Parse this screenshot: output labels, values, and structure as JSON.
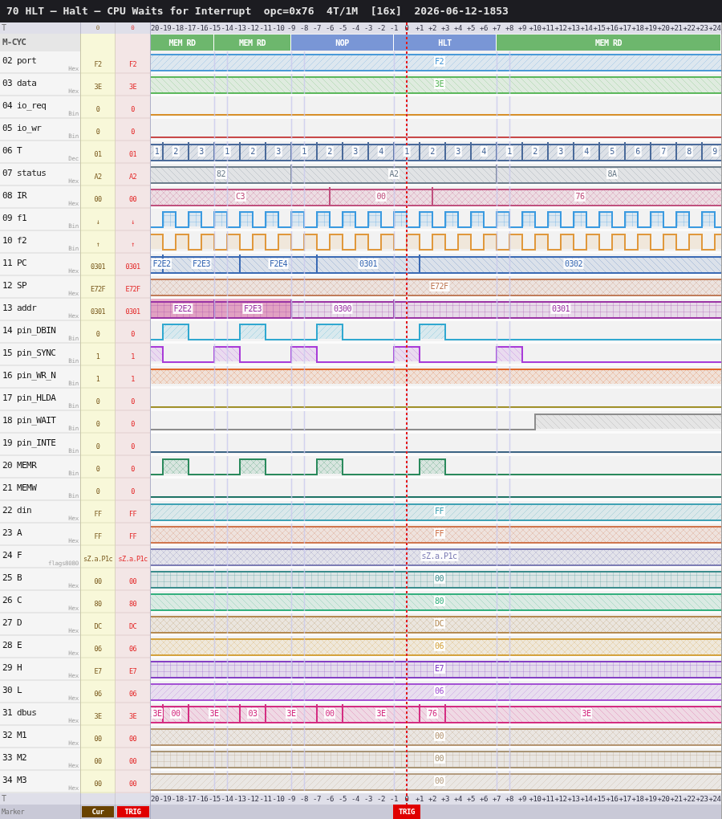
{
  "title_bar": {
    "title": "70 HLT — Halt — CPU Waits for Interrupt",
    "opcode": "opc=0x76",
    "timing": "4T/1M",
    "zoom": "[16x]",
    "timestamp": "2026-06-12-1853"
  },
  "ruler_top": {
    "label": "T",
    "cursor_value": "0",
    "trigger_value": "0",
    "ticks": [
      "20",
      "-19",
      "-18",
      "-17",
      "-16",
      "-15",
      "-14",
      "-13",
      "-12",
      "-11",
      "-10",
      "-9",
      "-8",
      "-7",
      "-6",
      "-5",
      "-4",
      "-3",
      "-2",
      "-1",
      "0",
      "+1",
      "+2",
      "+3",
      "+4",
      "+5",
      "+6",
      "+7",
      "+8",
      "+9",
      "+10",
      "+11",
      "+12",
      "+13",
      "+14",
      "+15",
      "+16",
      "+17",
      "+18",
      "+19",
      "+20",
      "+21",
      "+22",
      "+23",
      "+24"
    ]
  },
  "machine_cycles": {
    "label": "M-CYC",
    "segments": [
      {
        "label": "MEM RD",
        "color": "#6db76d"
      },
      {
        "label": "MEM RD",
        "color": "#6db76d"
      },
      {
        "label": "NOP",
        "color": "#7996d6"
      },
      {
        "label": "HLT",
        "color": "#7996d6"
      },
      {
        "label": "MEM RD",
        "color": "#6db76d"
      }
    ]
  },
  "signals": [
    {
      "name": "02 port",
      "format": "Hex",
      "cursor_value": "F2",
      "trigger_value": "F2",
      "kind": "bus",
      "color": "#4a9ad8",
      "segments": [
        {
          "value": "F2"
        }
      ]
    },
    {
      "name": "03 data",
      "format": "Hex",
      "cursor_value": "3E",
      "trigger_value": "3E",
      "kind": "bus",
      "color": "#5cb85c",
      "segments": [
        {
          "value": "3E"
        }
      ]
    },
    {
      "name": "04 io_req",
      "format": "Bin",
      "cursor_value": "0",
      "trigger_value": "0",
      "kind": "bit",
      "color": "#d8902a"
    },
    {
      "name": "05 io_wr",
      "format": "Bin",
      "cursor_value": "0",
      "trigger_value": "0",
      "kind": "bit",
      "color": "#c84848"
    },
    {
      "name": "06 T",
      "format": "Dec",
      "cursor_value": "01",
      "trigger_value": "01",
      "kind": "bus",
      "color": "#4a6a9a",
      "segments": [
        {
          "value": "1"
        },
        {
          "value": "2"
        },
        {
          "value": "3"
        },
        {
          "value": "1"
        },
        {
          "value": "2"
        },
        {
          "value": "3"
        },
        {
          "value": "1"
        },
        {
          "value": "2"
        },
        {
          "value": "3"
        },
        {
          "value": "4"
        },
        {
          "value": "1"
        },
        {
          "value": "2"
        },
        {
          "value": "3"
        },
        {
          "value": "4"
        },
        {
          "value": "1"
        },
        {
          "value": "2"
        },
        {
          "value": "3"
        },
        {
          "value": "4"
        },
        {
          "value": "5"
        },
        {
          "value": "6"
        },
        {
          "value": "7"
        },
        {
          "value": "8"
        },
        {
          "value": "9"
        }
      ]
    },
    {
      "name": "07 status",
      "format": "Hex",
      "cursor_value": "A2",
      "trigger_value": "A2",
      "kind": "bus",
      "color": "#6e7e8c",
      "segments": [
        {
          "value": "82"
        },
        {
          "value": "A2"
        },
        {
          "value": "8A"
        }
      ]
    },
    {
      "name": "08 IR",
      "format": "Hex",
      "cursor_value": "00",
      "trigger_value": "00",
      "kind": "bus",
      "color": "#c0507e",
      "segments": [
        {
          "value": "C3"
        },
        {
          "value": "00"
        },
        {
          "value": "76"
        }
      ]
    },
    {
      "name": "09 f1",
      "format": "Bin",
      "cursor_value": "↓",
      "trigger_value": "↓",
      "kind": "bit",
      "color": "#3a9ae0"
    },
    {
      "name": "10 f2",
      "format": "Bin",
      "cursor_value": "↑",
      "trigger_value": "↑",
      "kind": "bit",
      "color": "#e0983c"
    },
    {
      "name": "11 PC",
      "format": "Hex",
      "cursor_value": "0301",
      "trigger_value": "0301",
      "kind": "bus",
      "color": "#3a6ab4",
      "segments": [
        {
          "value": "F2E2"
        },
        {
          "value": "F2E3"
        },
        {
          "value": "F2E4"
        },
        {
          "value": "0301"
        },
        {
          "value": "0302"
        }
      ]
    },
    {
      "name": "12 SP",
      "format": "Hex",
      "cursor_value": "E72F",
      "trigger_value": "E72F",
      "kind": "bus",
      "color": "#c07c5a",
      "segments": [
        {
          "value": "E72F"
        }
      ]
    },
    {
      "name": "13 addr",
      "format": "Hex",
      "cursor_value": "0301",
      "trigger_value": "0301",
      "kind": "bus",
      "color": "#9a34a4",
      "segments": [
        {
          "value": "F2E2",
          "highlighted": true
        },
        {
          "value": "F2E3",
          "highlighted": true
        },
        {
          "value": "0300",
          "highlighted": false
        },
        {
          "value": "0301",
          "highlighted": false
        }
      ]
    },
    {
      "name": "14 pin_DBIN",
      "format": "Bin",
      "cursor_value": "0",
      "trigger_value": "0",
      "kind": "bit",
      "color": "#30a8d0"
    },
    {
      "name": "15 pin_SYNC",
      "format": "Bin",
      "cursor_value": "1",
      "trigger_value": "1",
      "kind": "bit",
      "color": "#a83cd8"
    },
    {
      "name": "16 pin_WR_N",
      "format": "Bin",
      "cursor_value": "1",
      "trigger_value": "1",
      "kind": "bit",
      "color": "#e0682a"
    },
    {
      "name": "17 pin_HLDA",
      "format": "Bin",
      "cursor_value": "0",
      "trigger_value": "0",
      "kind": "bit",
      "color": "#a09028"
    },
    {
      "name": "18 pin_WAIT",
      "format": "Bin",
      "cursor_value": "0",
      "trigger_value": "0",
      "kind": "bit",
      "color": "#8c8c8c"
    },
    {
      "name": "19 pin_INTE",
      "format": "Bin",
      "cursor_value": "0",
      "trigger_value": "0",
      "kind": "bit",
      "color": "#3c6484"
    },
    {
      "name": "20 MEMR",
      "format": "Bin",
      "cursor_value": "0",
      "trigger_value": "0",
      "kind": "bit",
      "color": "#2a8a5c"
    },
    {
      "name": "21 MEMW",
      "format": "Bin",
      "cursor_value": "0",
      "trigger_value": "0",
      "kind": "bit",
      "color": "#1e7466"
    },
    {
      "name": "22 din",
      "format": "Hex",
      "cursor_value": "FF",
      "trigger_value": "FF",
      "kind": "bus",
      "color": "#40a2b4",
      "segments": [
        {
          "value": "FF"
        }
      ]
    },
    {
      "name": "23 A",
      "format": "Hex",
      "cursor_value": "FF",
      "trigger_value": "FF",
      "kind": "bus",
      "color": "#d0764e",
      "segments": [
        {
          "value": "FF"
        }
      ]
    },
    {
      "name": "24 F",
      "format": "flags8080",
      "cursor_value": "sZ.a.P1c",
      "trigger_value": "sZ.a.P1c",
      "kind": "bus",
      "color": "#7c7cb4",
      "segments": [
        {
          "value": "sZ.a.P1c"
        }
      ]
    },
    {
      "name": "25 B",
      "format": "Hex",
      "cursor_value": "00",
      "trigger_value": "00",
      "kind": "bus",
      "color": "#3a8c8c",
      "segments": [
        {
          "value": "00"
        }
      ]
    },
    {
      "name": "26 C",
      "format": "Hex",
      "cursor_value": "80",
      "trigger_value": "80",
      "kind": "bus",
      "color": "#34b07e",
      "segments": [
        {
          "value": "80"
        }
      ]
    },
    {
      "name": "27 D",
      "format": "Hex",
      "cursor_value": "DC",
      "trigger_value": "DC",
      "kind": "bus",
      "color": "#b48a52",
      "segments": [
        {
          "value": "DC"
        }
      ]
    },
    {
      "name": "28 E",
      "format": "Hex",
      "cursor_value": "06",
      "trigger_value": "06",
      "kind": "bus",
      "color": "#d4a23c",
      "segments": [
        {
          "value": "06"
        }
      ]
    },
    {
      "name": "29 H",
      "format": "Hex",
      "cursor_value": "E7",
      "trigger_value": "E7",
      "kind": "bus",
      "color": "#8440c4",
      "segments": [
        {
          "value": "E7"
        }
      ]
    },
    {
      "name": "30 L",
      "format": "Hex",
      "cursor_value": "06",
      "trigger_value": "06",
      "kind": "bus",
      "color": "#a452d4",
      "segments": [
        {
          "value": "06"
        }
      ]
    },
    {
      "name": "31 dbus",
      "format": "Hex",
      "cursor_value": "3E",
      "trigger_value": "3E",
      "kind": "bus",
      "color": "#d42e82",
      "segments": [
        {
          "value": "3E"
        },
        {
          "value": "00"
        },
        {
          "value": "3E"
        },
        {
          "value": "03"
        },
        {
          "value": "3E"
        },
        {
          "value": "00"
        },
        {
          "value": "3E"
        },
        {
          "value": "76"
        },
        {
          "value": "3E"
        }
      ]
    },
    {
      "name": "32 M1",
      "format": "Hex",
      "cursor_value": "00",
      "trigger_value": "00",
      "kind": "bus",
      "color": "#b49470",
      "segments": [
        {
          "value": "00"
        }
      ]
    },
    {
      "name": "33 M2",
      "format": "Hex",
      "cursor_value": "00",
      "trigger_value": "00",
      "kind": "bus",
      "color": "#a89474",
      "segments": [
        {
          "value": "00"
        }
      ]
    },
    {
      "name": "34 M3",
      "format": "Hex",
      "cursor_value": "00",
      "trigger_value": "00",
      "kind": "bus",
      "color": "#b49c80",
      "segments": [
        {
          "value": "00"
        }
      ]
    }
  ],
  "ruler_bottom": {
    "label": "T",
    "ticks": [
      "20",
      "-19",
      "-18",
      "-17",
      "-16",
      "-15",
      "-14",
      "-13",
      "-12",
      "-11",
      "-10",
      "-9",
      "-8",
      "-7",
      "-6",
      "-5",
      "-4",
      "-3",
      "-2",
      "-1",
      "0",
      "+1",
      "+2",
      "+3",
      "+4",
      "+5",
      "+6",
      "+7",
      "+8",
      "+9",
      "+10",
      "+11",
      "+12",
      "+13",
      "+14",
      "+15",
      "+16",
      "+17",
      "+18",
      "+19",
      "+20",
      "+21",
      "+22",
      "+23",
      "+24"
    ]
  },
  "marker_bar": {
    "label": "Marker",
    "cursor_button": "Cur",
    "trigger_button": "TRIG",
    "trigger_flag": {
      "label": "TRIG"
    }
  }
}
